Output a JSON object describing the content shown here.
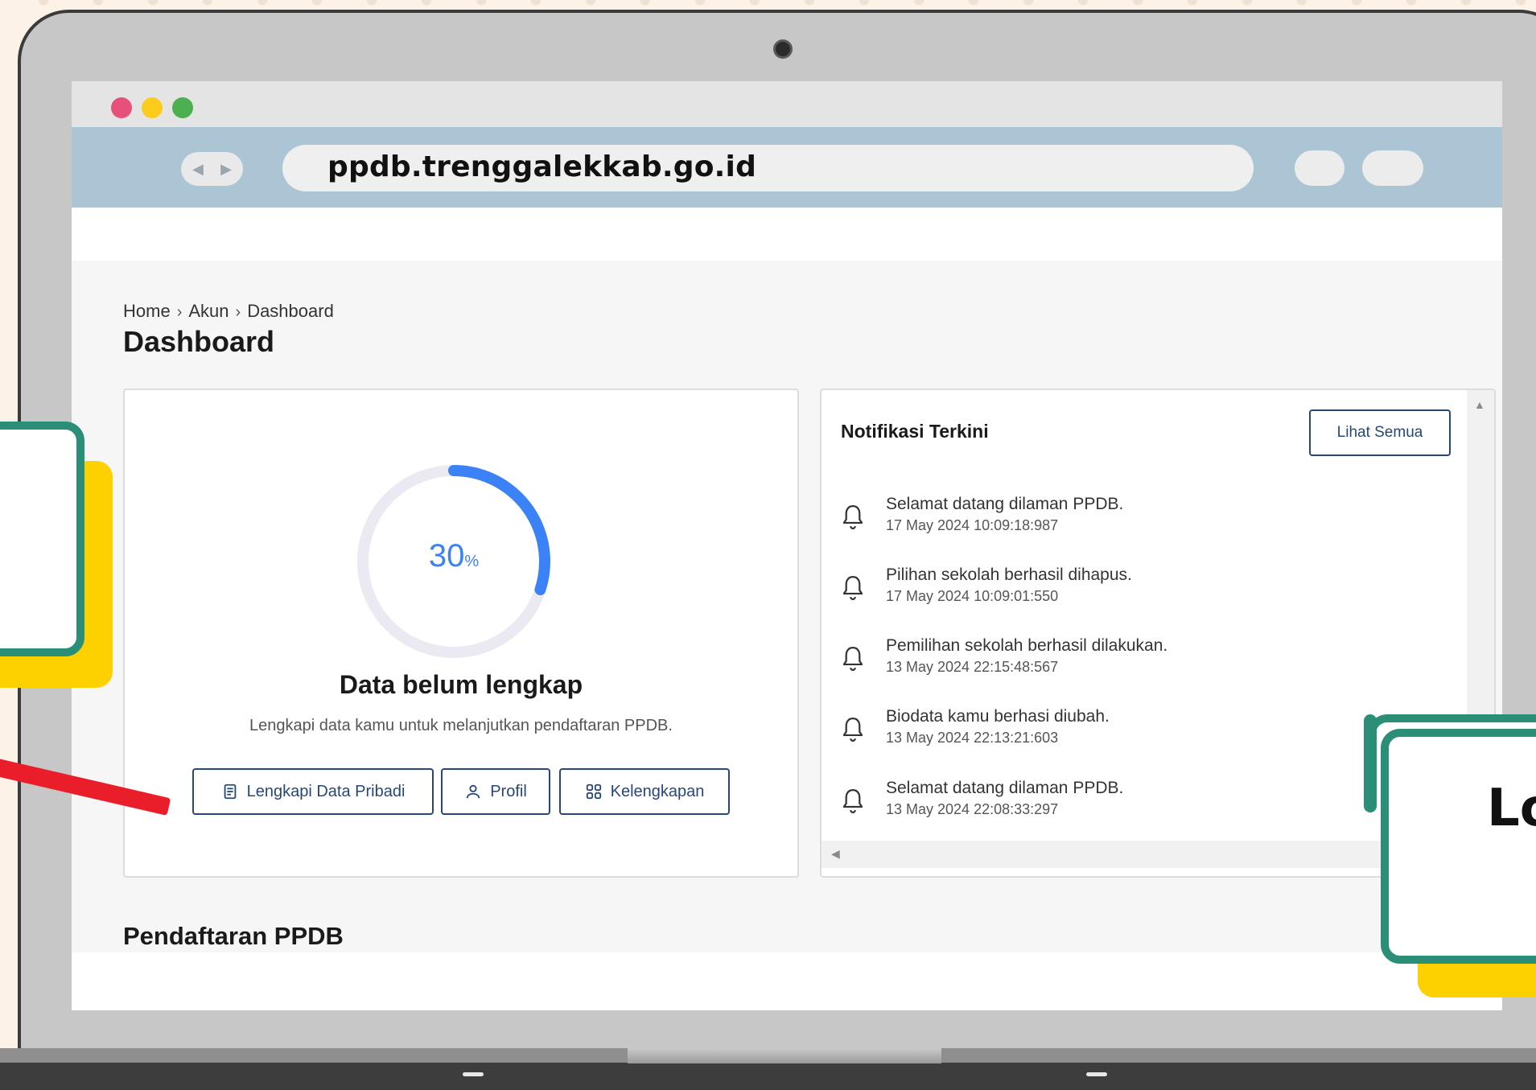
{
  "browser": {
    "url": "ppdb.trenggalekkab.go.id",
    "traffic_lights": [
      "#e6507a",
      "#fccb1b",
      "#4caf50"
    ]
  },
  "breadcrumb": [
    "Home",
    "Akun",
    "Dashboard"
  ],
  "page_title": "Dashboard",
  "profile_card": {
    "progress": {
      "value": "30",
      "unit": "%",
      "fraction": 0.3
    },
    "status_title": "Data belum lengkap",
    "status_desc": "Lengkapi data kamu untuk melanjutkan pendaftaran PPDB.",
    "buttons": [
      {
        "label": "Lengkapi Data Pribadi",
        "icon": "document-icon"
      },
      {
        "label": "Profil",
        "icon": "user-icon"
      },
      {
        "label": "Kelengkapan",
        "icon": "grid-icon"
      }
    ]
  },
  "notifications": {
    "title": "Notifikasi Terkini",
    "see_all": "Lihat Semua",
    "items": [
      {
        "message": "Selamat datang dilaman PPDB.",
        "time": "17 May 2024 10:09:18:987"
      },
      {
        "message": "Pilihan sekolah berhasil dihapus.",
        "time": "17 May 2024 10:09:01:550"
      },
      {
        "message": "Pemilihan sekolah berhasil dilakukan.",
        "time": "13 May 2024 22:15:48:567"
      },
      {
        "message": "Biodata kamu berhasi diubah.",
        "time": "13 May 2024 22:13:21:603"
      },
      {
        "message": "Selamat datang dilaman PPDB.",
        "time": "13 May 2024 22:08:33:297"
      }
    ]
  },
  "section_title": "Pendaftaran PPDB",
  "callout_fragment": "Lo",
  "colors": {
    "accent_blue": "#3b82f6",
    "button_navy": "#27477a",
    "callout_green": "#2b8f77",
    "callout_yellow": "#fdd000",
    "arrow_red": "#ea1e2a"
  }
}
